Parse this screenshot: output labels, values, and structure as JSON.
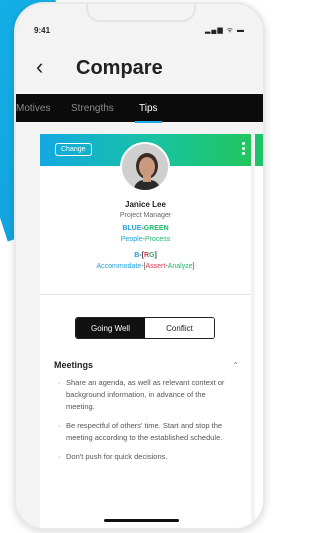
{
  "status": {
    "time": "9:41",
    "icons": "▂▄▆ ᯤ ▬"
  },
  "header": {
    "back": "‹",
    "title": "Compare"
  },
  "tabs": [
    "Motives",
    "Strengths",
    "Tips"
  ],
  "card": {
    "change": "Change",
    "name": "Janice Lee",
    "role": "Project Manager",
    "color_a": "BLUE",
    "color_sep": "-",
    "color_b": "GREEN",
    "pp_a": "People",
    "pp_sep": "-",
    "pp_b": "Process",
    "blend_b": "B",
    "blend_dash": "-",
    "blend_bracket_open": "[",
    "blend_r": "R",
    "blend_g": "G",
    "blend_bracket_close": "]",
    "aaa_a": "Accommodate",
    "aaa_dash": "-",
    "aaa_bracket_open": "[",
    "aaa_b": "Assert",
    "aaa_dash2": "-",
    "aaa_c": "Analyze",
    "aaa_bracket_close": "]"
  },
  "segment": {
    "left": "Going Well",
    "right": "Conflict"
  },
  "section": {
    "title": "Meetings",
    "tips": [
      "Share an agenda, as well as relevant context or background information, in advance of the meeting.",
      "Be respectful of others' time. Start and stop the meeting according to the established schedule.",
      "Don't push for quick decisions."
    ]
  },
  "colors": {
    "blue": "#1ea0e0",
    "green": "#20b86a",
    "red": "#e0344b",
    "tab_accent": "#1fa6e8"
  }
}
